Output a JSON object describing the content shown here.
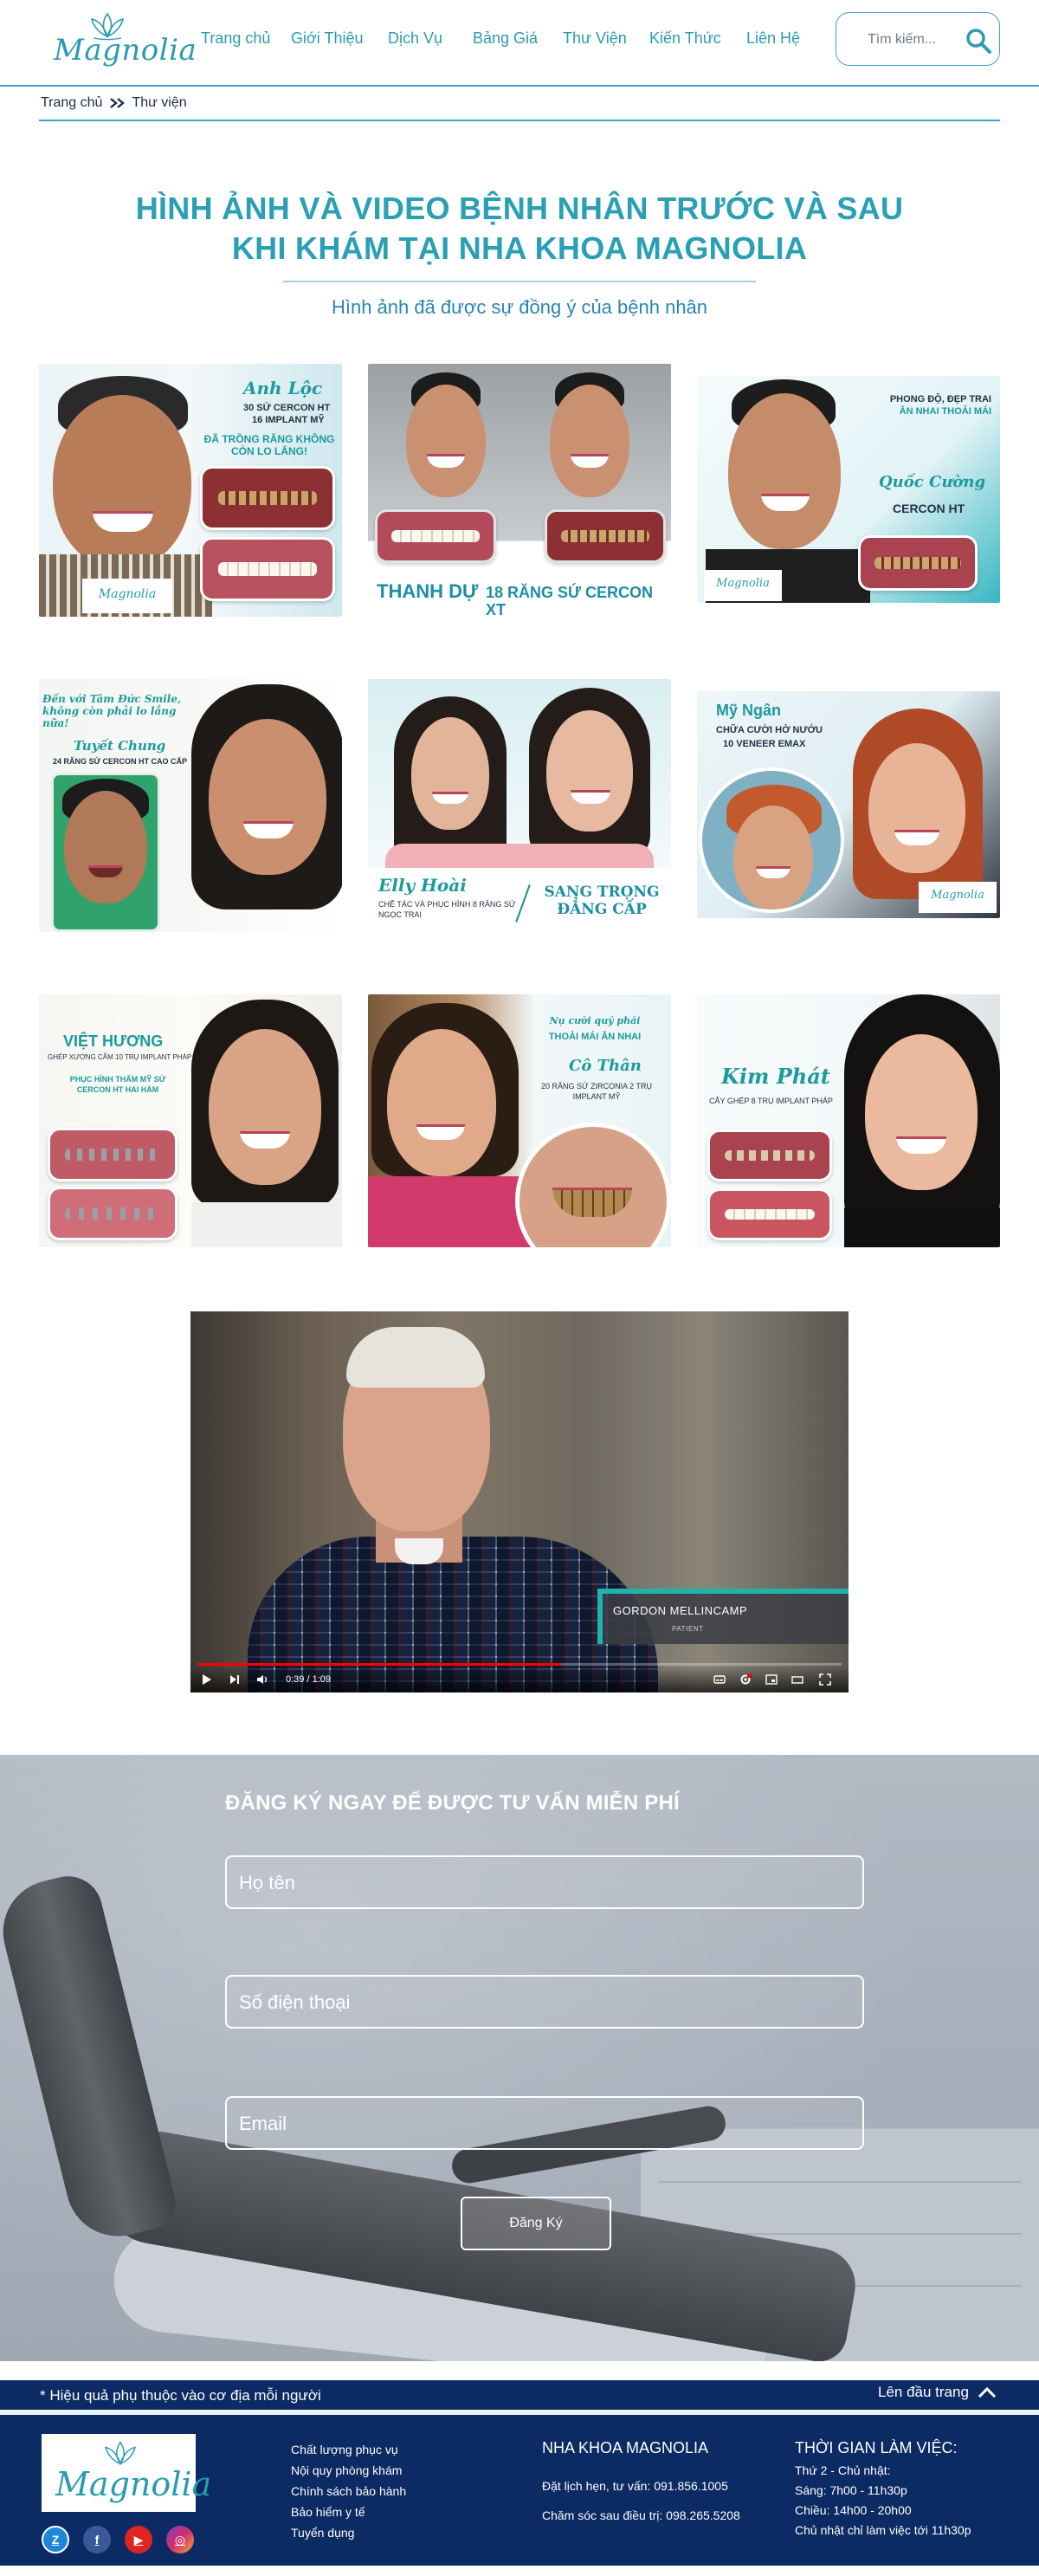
{
  "header": {
    "logo_text": "Magnolia",
    "nav": [
      "Trang chủ",
      "Giới Thiệu",
      "Dịch Vụ",
      "Bảng Giá",
      "Thư Viện",
      "Kiến Thức",
      "Liên Hệ"
    ],
    "search_placeholder": "Tìm kiếm..."
  },
  "breadcrumb": {
    "home": "Trang chủ",
    "current": "Thư viện"
  },
  "page": {
    "title_line1": "HÌNH ẢNH VÀ VIDEO BỆNH NHÂN TRƯỚC VÀ SAU",
    "title_line2": "KHI KHÁM TẠI NHA KHOA MAGNOLIA",
    "subtitle": "Hình ảnh đã được sự đồng ý của bệnh nhân"
  },
  "gallery": [
    {
      "name": "Anh Lộc",
      "caption1": "30 SỨ CERCON HT",
      "caption2": "16 IMPLANT MỸ",
      "caption3": "ĐÃ TRỒNG RĂNG KHÔNG CÒN LO LẮNG!",
      "logo": "Magnolia"
    },
    {
      "name": "THANH DỰ",
      "caption1": "18 RĂNG SỨ CERCON XT"
    },
    {
      "name": "Quốc Cường",
      "caption1": "PHONG ĐỘ, ĐẸP TRAI",
      "caption2": "ĂN NHAI THOẢI MÁI",
      "caption3": "CERCON HT",
      "logo": "Magnolia"
    },
    {
      "name": "Tuyết Chung",
      "caption1": "Đến với Tâm Đức Smile, không còn phải lo lắng nữa!",
      "caption2": "24 RĂNG SỨ CERCON HT CAO CẤP"
    },
    {
      "name": "Elly Hoài",
      "caption1": "CHẾ TÁC VÀ PHỤC HÌNH 8 RĂNG SỨ NGỌC TRAI",
      "caption2": "SANG TRỌNG ĐẲNG CẤP"
    },
    {
      "name": "Mỹ Ngân",
      "caption1": "CHỮA CƯỜI HỞ NƯỚU",
      "caption2": "10 VENEER EMAX",
      "logo": "Magnolia"
    },
    {
      "name": "VIỆT HƯƠNG",
      "caption1": "GHÉP XƯƠNG CẰM 10 TRỤ IMPLANT PHÁP",
      "caption2": "PHỤC HÌNH THẨM MỸ SỨ CERCON HT HAI HÀM"
    },
    {
      "name": "Cô Thân",
      "caption1": "Nụ cười quý phái",
      "caption2": "THOẢI MÁI ĂN NHAI",
      "caption3": "20 RĂNG SỨ ZIRCONIA 2 TRỤ IMPLANT MỸ"
    },
    {
      "name": "Kim Phát",
      "caption1": "CẤY GHÉP 8 TRỤ IMPLANT PHÁP"
    }
  ],
  "video": {
    "person_name": "GORDON MELLINCAMP",
    "person_role": "PATIENT",
    "time": "0:39 / 1:09",
    "progress": 0.565
  },
  "register": {
    "heading": "ĐĂNG KÝ NGAY ĐỂ ĐƯỢC TƯ VẤN MIỄN PHÍ",
    "name_placeholder": "Họ tên",
    "phone_placeholder": "Số điện thoại",
    "email_placeholder": "Email",
    "submit_label": "Đăng Ký"
  },
  "notice": {
    "text": "* Hiệu quả phụ thuộc vào cơ địa mỗi người",
    "to_top": "Lên đầu trang"
  },
  "footer": {
    "logo_text": "Magnolia",
    "links": [
      "Chất lượng phục vụ",
      "Nội quy phòng khám",
      "Chính sách bảo hành",
      "Bảo hiểm y tế",
      "Tuyển dụng"
    ],
    "clinic_title": "NHA KHOA MAGNOLIA",
    "booking": "Đặt lịch hẹn, tư vấn: 091.856.1005",
    "care": "Chăm sóc sau điều trị: 098.265.5208",
    "hours_title": "THỜI GIAN LÀM VIỆC:",
    "hours": [
      "Thứ 2 - Chủ nhật:",
      "Sáng: 7h00 - 11h30p",
      "Chiều: 14h00 - 20h00",
      "Chủ nhật chỉ làm việc tới 11h30p"
    ],
    "socials": [
      "zalo-icon",
      "facebook-icon",
      "youtube-icon",
      "instagram-icon"
    ]
  },
  "colors": {
    "brand": "#2aa0b5",
    "navy": "#0c2a63",
    "accent_red": "#ff0000"
  }
}
